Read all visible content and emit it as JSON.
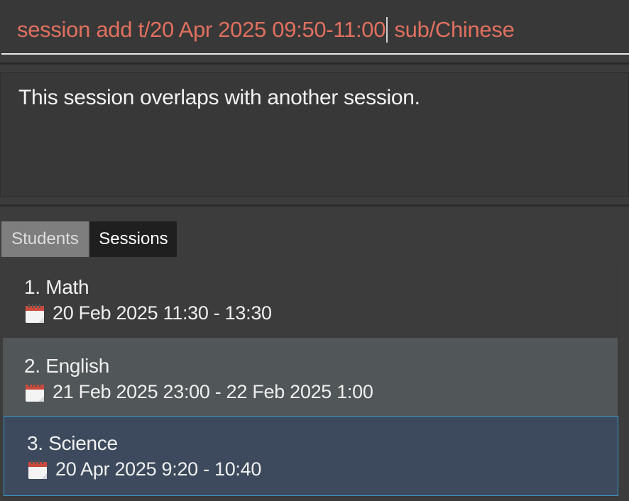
{
  "command": {
    "before_caret": "session add t/20 Apr 2025 09:50-11:00",
    "after_caret": " sub/Chinese",
    "error_color": "#e0705f"
  },
  "result": {
    "message": "This session overlaps with another session."
  },
  "tabs": [
    {
      "label": "Students",
      "active": false
    },
    {
      "label": "Sessions",
      "active": true
    }
  ],
  "sessions": [
    {
      "title": "1. Math",
      "date": "20 Feb 2025 11:30 - 13:30",
      "icon": "calendar-icon"
    },
    {
      "title": "2. English",
      "date": "21 Feb 2025 23:00 - 22 Feb 2025 1:00",
      "icon": "calendar-icon"
    },
    {
      "title": "3. Science",
      "date": "20 Apr 2025 9:20 - 10:40",
      "icon": "calendar-icon",
      "selected": true
    }
  ]
}
